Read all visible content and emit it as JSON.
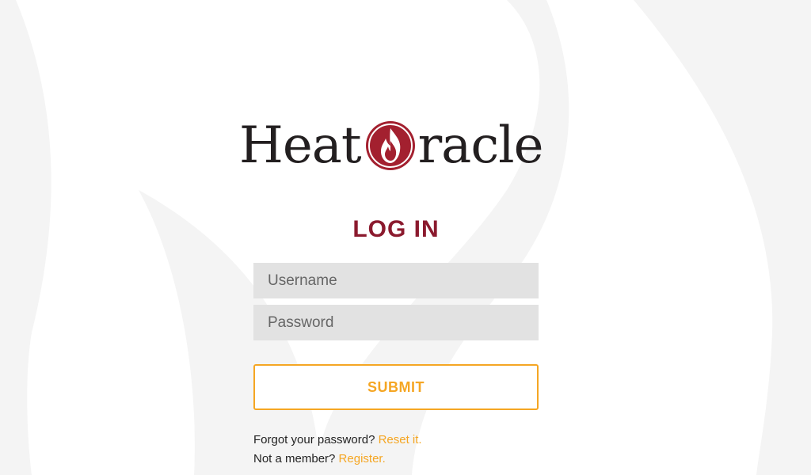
{
  "brand": {
    "name_prefix": "Heat",
    "name_suffix": "racle",
    "logo_icon": "flame-circle-icon",
    "primary_color": "#8b1a2e",
    "accent_color": "#f5a623"
  },
  "login": {
    "heading": "LOG IN",
    "username_placeholder": "Username",
    "password_placeholder": "Password",
    "submit_label": "SUBMIT"
  },
  "help": {
    "forgot_text": "Forgot your password?",
    "reset_link": "Reset it.",
    "member_text": "Not a member?",
    "register_link": "Register."
  }
}
